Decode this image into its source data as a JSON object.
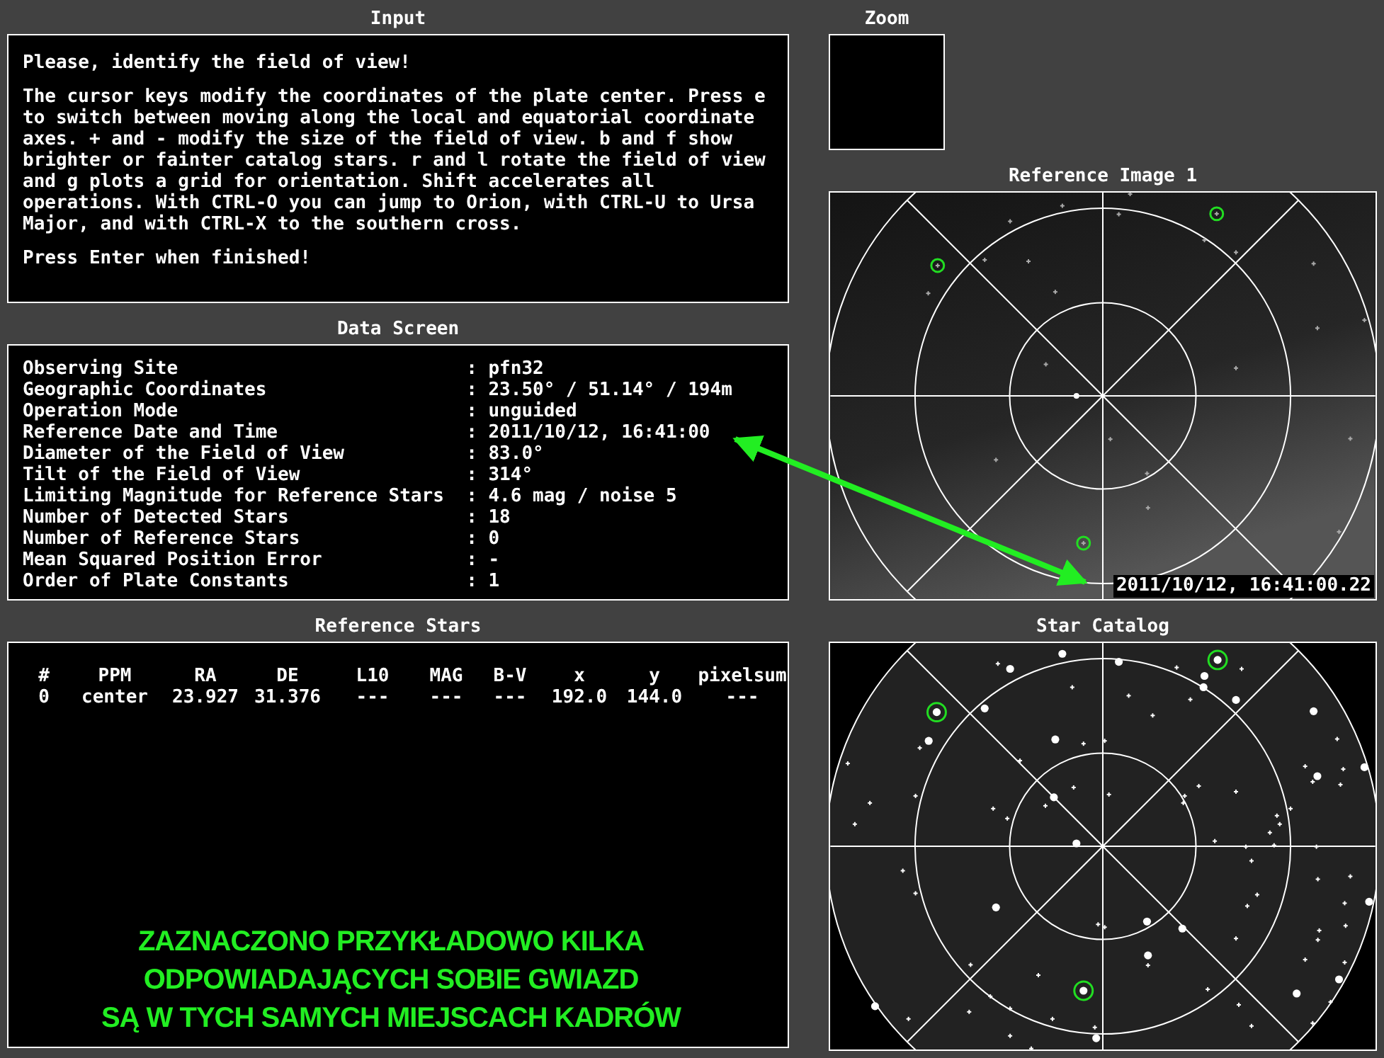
{
  "input_panel": {
    "title": "Input",
    "heading": "Please, identify the field of view!",
    "instructions": "The cursor keys modify the coordinates of the plate center. Press e to switch between moving along the local and equatorial coordinate axes. + and - modify the size of the field of view. b and f show brighter or fainter catalog stars. r and l rotate the field of view and g plots a grid for orientation. Shift accelerates all operations. With CTRL-O you can jump to Orion, with CTRL-U to Ursa Major, and with CTRL-X to the southern cross.",
    "footer": "Press Enter when finished!"
  },
  "data_screen": {
    "title": "Data Screen",
    "rows": [
      {
        "label": "Observing Site",
        "value": ": pfn32"
      },
      {
        "label": "Geographic Coordinates",
        "value": ": 23.50° / 51.14° / 194m"
      },
      {
        "label": "Operation Mode",
        "value": ": unguided"
      },
      {
        "label": "Reference Date and Time",
        "value": ": 2011/10/12, 16:41:00"
      },
      {
        "label": "Diameter of the Field of View",
        "value": ": 83.0°"
      },
      {
        "label": "Tilt of the Field of View",
        "value": ": 314°"
      },
      {
        "label": "Limiting Magnitude for Reference Stars",
        "value": ": 4.6 mag / noise 5"
      },
      {
        "label": "Number of Detected Stars",
        "value": ": 18"
      },
      {
        "label": "Number of Reference Stars",
        "value": ": 0"
      },
      {
        "label": "Mean Squared Position Error",
        "value": ": -"
      },
      {
        "label": "Order of Plate Constants",
        "value": ": 1"
      }
    ]
  },
  "reference_stars": {
    "title": "Reference Stars",
    "columns": [
      "#",
      "PPM",
      "RA",
      "DE",
      "L10",
      "MAG",
      "B-V",
      "x",
      "y",
      "pixelsum"
    ],
    "rows": [
      [
        "0",
        "center",
        "23.927",
        "31.376",
        "---",
        "---",
        "---",
        "192.0",
        "144.0",
        "---"
      ]
    ]
  },
  "annotation": {
    "lines": [
      "ZAZNACZONO PRZYKŁADOWO KILKA",
      "ODPOWIADAJĄCYCH SOBIE GWIAZD",
      "SĄ W TYCH SAMYCH MIEJSCACH KADRÓW"
    ]
  },
  "zoom": {
    "title": "Zoom"
  },
  "reference_image": {
    "title": "Reference Image 1",
    "timestamp": "2011/10/12, 16:41:00.22"
  },
  "star_catalog": {
    "title": "Star Catalog"
  }
}
